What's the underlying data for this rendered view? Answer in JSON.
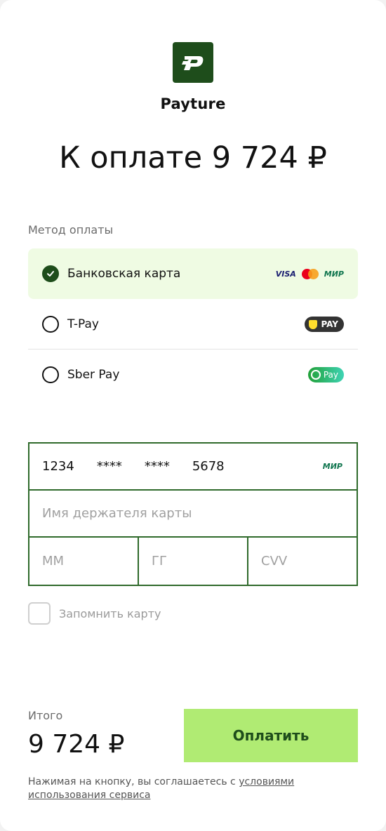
{
  "brand": {
    "name": "Payture",
    "icon": "payture-logo-icon",
    "color": "#1e4d1b"
  },
  "amount_title": "К оплате 9 724 ₽",
  "payment_method": {
    "label": "Метод оплаты",
    "options": [
      {
        "label": "Банковская карта",
        "selected": true,
        "logos": [
          "VISA",
          "mastercard",
          "МИР"
        ]
      },
      {
        "label": "T-Pay",
        "selected": false,
        "badge": "PAY"
      },
      {
        "label": "Sber Pay",
        "selected": false,
        "badge": "Pay"
      }
    ]
  },
  "card": {
    "number_groups": [
      "1234",
      "****",
      "****",
      "5678"
    ],
    "network": "МИР",
    "holder_placeholder": "Имя держателя карты",
    "month_placeholder": "ММ",
    "year_placeholder": "ГГ",
    "cvv_placeholder": "CVV"
  },
  "remember_card": {
    "label": "Запомнить карту",
    "checked": false
  },
  "total": {
    "label": "Итого",
    "value": "9 724 ₽"
  },
  "pay_button": "Оплатить",
  "terms": {
    "text": "Нажимая на кнопку, вы соглашаетесь с ",
    "link": "условиями использования сервиса"
  },
  "colors": {
    "accent": "#b0eb73",
    "dark_green": "#1e4d1b",
    "selected_bg": "#effbe3",
    "border": "#2f6a2b"
  }
}
